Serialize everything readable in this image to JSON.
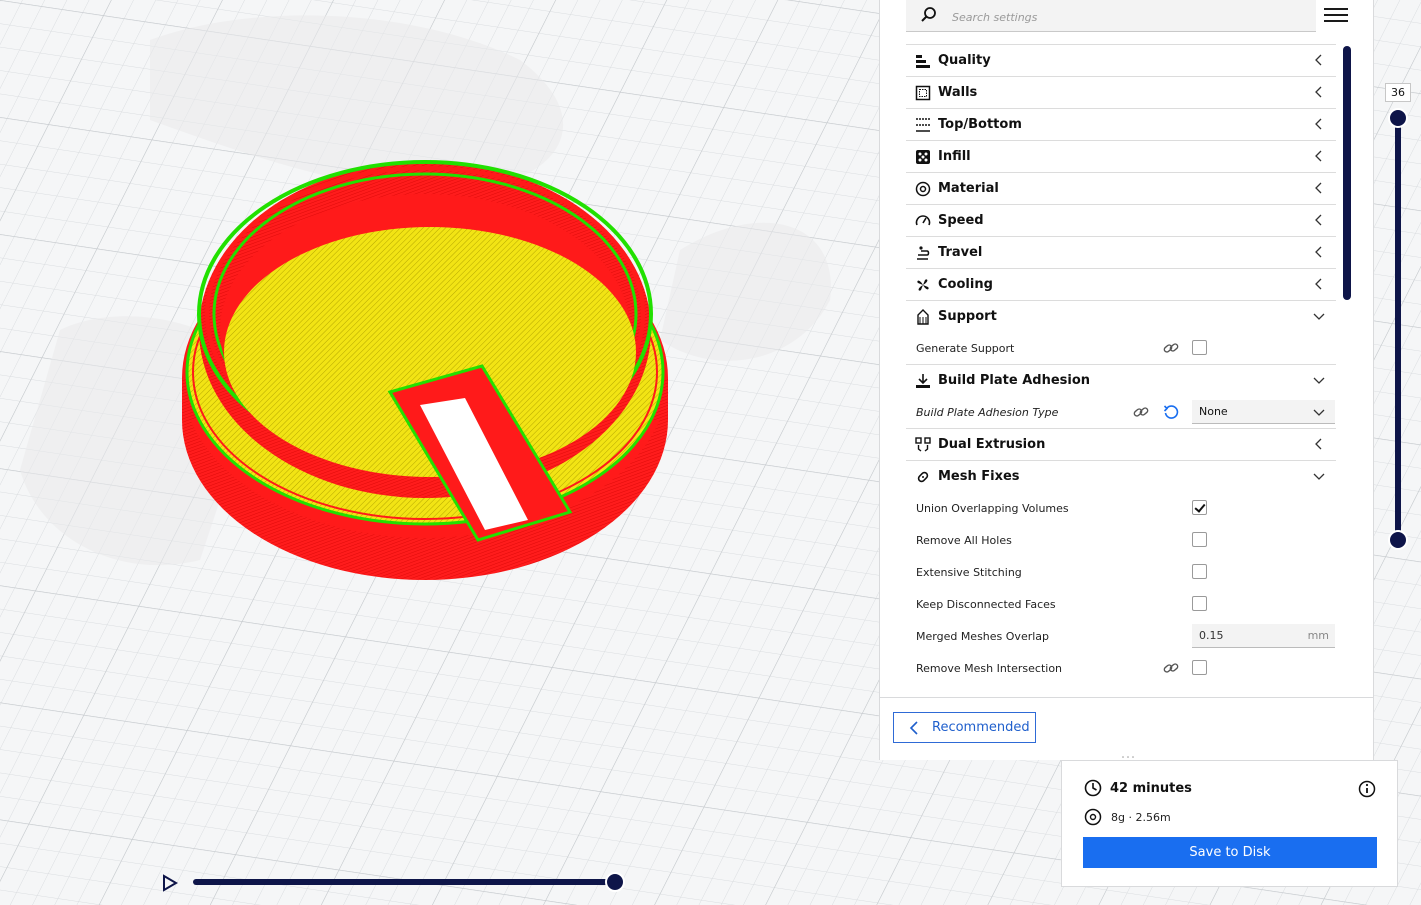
{
  "search": {
    "placeholder": "Search settings"
  },
  "categories": {
    "quality": "Quality",
    "walls": "Walls",
    "top_bottom": "Top/Bottom",
    "infill": "Infill",
    "material": "Material",
    "speed": "Speed",
    "travel": "Travel",
    "cooling": "Cooling",
    "support": "Support",
    "adhesion": "Build Plate Adhesion",
    "dual": "Dual Extrusion",
    "mesh": "Mesh Fixes"
  },
  "settings": {
    "generate_support": {
      "label": "Generate Support",
      "checked": false
    },
    "adhesion_type": {
      "label": "Build Plate Adhesion Type",
      "value": "None"
    },
    "union_overlapping": {
      "label": "Union Overlapping Volumes",
      "checked": true
    },
    "remove_holes": {
      "label": "Remove All Holes",
      "checked": false
    },
    "extensive_stitching": {
      "label": "Extensive Stitching",
      "checked": false
    },
    "keep_disconnected": {
      "label": "Keep Disconnected Faces",
      "checked": false
    },
    "merged_overlap": {
      "label": "Merged Meshes Overlap",
      "value": "0.15",
      "unit": "mm"
    },
    "remove_intersection": {
      "label": "Remove Mesh Intersection",
      "checked": false
    }
  },
  "footer": {
    "recommended_label": "Recommended"
  },
  "estimate": {
    "time": "42 minutes",
    "material": "8g · 2.56m",
    "save_label": "Save to Disk"
  },
  "layer_view": {
    "current_layer": "36"
  },
  "colors": {
    "accent": "#196ef0",
    "dark": "#0e1549",
    "wall": "#ff1a1a",
    "inner_wall": "#22e000",
    "skin": "#f5e81a"
  }
}
